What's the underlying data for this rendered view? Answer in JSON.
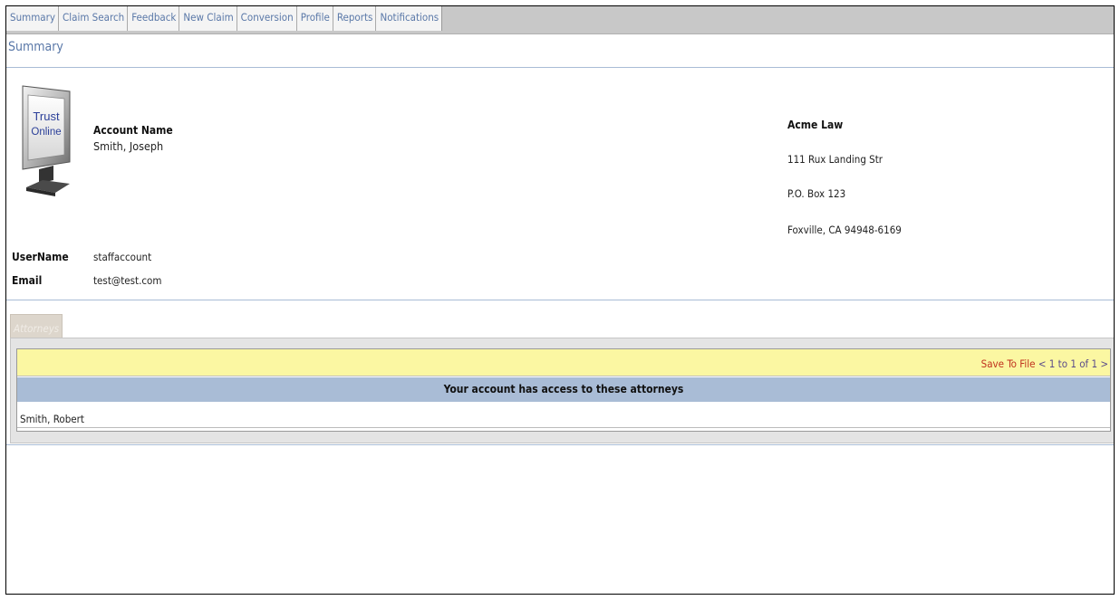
{
  "nav": {
    "tabs": [
      "Summary",
      "Claim Search",
      "Feedback",
      "New Claim",
      "Conversion",
      "Profile",
      "Reports",
      "Notifications"
    ]
  },
  "page": {
    "title": "Summary"
  },
  "logo": {
    "line1": "Trust",
    "line2": "Online"
  },
  "account": {
    "name_label": "Account Name",
    "name_value": "Smith, Joseph",
    "username_label": "UserName",
    "username_value": "staffaccount",
    "email_label": "Email",
    "email_value": "test@test.com"
  },
  "firm": {
    "name": "Acme Law",
    "address1": "111 Rux Landing Str",
    "address2": "P.O. Box 123",
    "city_line": "Foxville, CA 94948-6169"
  },
  "attorneys": {
    "tab_label": "Attorneys",
    "save_link": "Save To File",
    "pager": "< 1 to 1 of 1 >",
    "header": "Your account has access to these attorneys",
    "rows": [
      "Smith, Robert"
    ]
  },
  "colors": {
    "nav_link": "#5a78a8",
    "rule_blue": "#a9bcd6",
    "toolbar_yellow": "#fbf7a2",
    "save_link": "#c0311d"
  }
}
